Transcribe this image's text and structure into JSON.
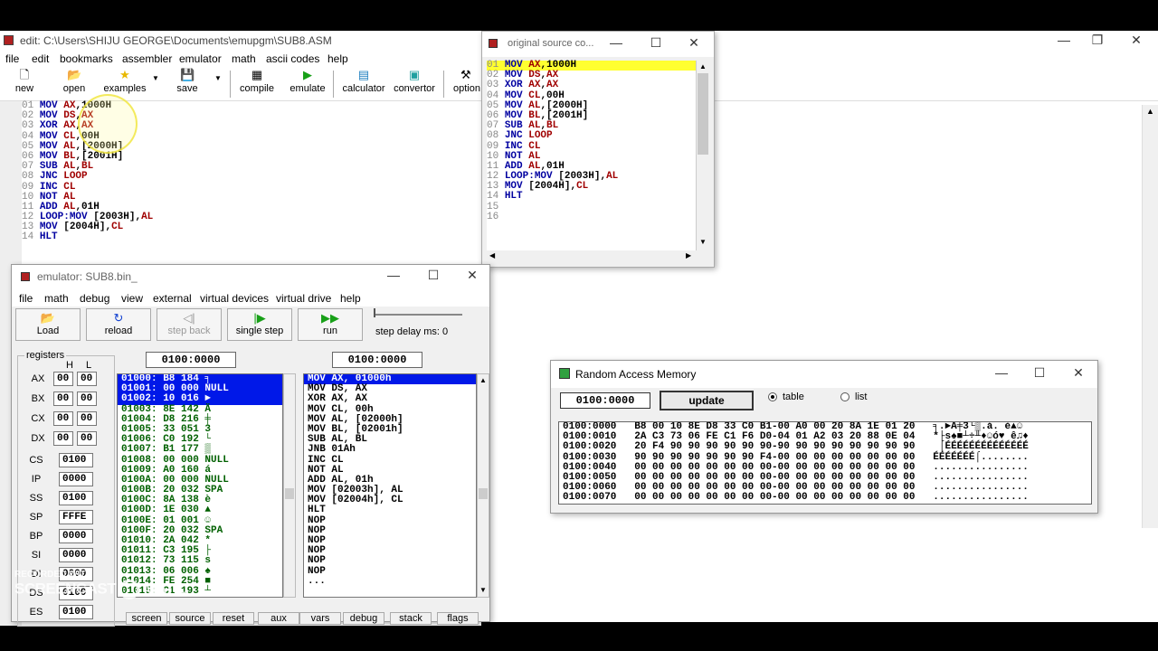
{
  "editor": {
    "title": "edit: C:\\Users\\SHIJU GEORGE\\Documents\\emupgm\\SUB8.ASM",
    "menu": [
      "file",
      "edit",
      "bookmarks",
      "assembler",
      "emulator",
      "math",
      "ascii codes",
      "help"
    ],
    "toolbar": {
      "new": "new",
      "open": "open",
      "examples": "examples",
      "save": "save",
      "compile": "compile",
      "emulate": "emulate",
      "calculator": "calculator",
      "convertor": "convertor",
      "options": "option"
    },
    "lines": [
      {
        "n": "01",
        "t": "MOV AX,1000H"
      },
      {
        "n": "02",
        "t": "MOV DS,AX"
      },
      {
        "n": "03",
        "t": "XOR AX,AX"
      },
      {
        "n": "04",
        "t": "MOV CL,00H"
      },
      {
        "n": "05",
        "t": "MOV AL,[2000H]"
      },
      {
        "n": "06",
        "t": "MOV BL,[2001H]"
      },
      {
        "n": "07",
        "t": "SUB AL,BL"
      },
      {
        "n": "08",
        "t": "JNC LOOP"
      },
      {
        "n": "09",
        "t": "INC CL"
      },
      {
        "n": "10",
        "t": "NOT AL"
      },
      {
        "n": "11",
        "t": "ADD AL,01H"
      },
      {
        "n": "12",
        "t": "LOOP:MOV [2003H],AL"
      },
      {
        "n": "13",
        "t": "MOV [2004H],CL"
      },
      {
        "n": "14",
        "t": "HLT"
      }
    ]
  },
  "source": {
    "title": "original source co...",
    "lines": [
      {
        "n": "01",
        "t": "MOV AX,1000H"
      },
      {
        "n": "02",
        "t": "MOV DS,AX"
      },
      {
        "n": "03",
        "t": "XOR AX,AX"
      },
      {
        "n": "04",
        "t": "MOV CL,00H"
      },
      {
        "n": "05",
        "t": "MOV AL,[2000H]"
      },
      {
        "n": "06",
        "t": "MOV BL,[2001H]"
      },
      {
        "n": "07",
        "t": "SUB AL,BL"
      },
      {
        "n": "08",
        "t": "JNC LOOP"
      },
      {
        "n": "09",
        "t": "INC CL"
      },
      {
        "n": "10",
        "t": "NOT AL"
      },
      {
        "n": "11",
        "t": "ADD AL,01H"
      },
      {
        "n": "12",
        "t": "LOOP:MOV [2003H],AL"
      },
      {
        "n": "13",
        "t": "MOV [2004H],CL"
      },
      {
        "n": "14",
        "t": "HLT"
      },
      {
        "n": "15",
        "t": ""
      },
      {
        "n": "16",
        "t": ""
      }
    ]
  },
  "emulator": {
    "title": "emulator: SUB8.bin_",
    "menu": [
      "file",
      "math",
      "debug",
      "view",
      "external",
      "virtual devices",
      "virtual drive",
      "help"
    ],
    "buttons": {
      "load": "Load",
      "reload": "reload",
      "step_back": "step back",
      "single_step": "single step",
      "run": "run"
    },
    "step_delay": "step delay ms: 0",
    "registers_label": "registers",
    "h_label": "H",
    "l_label": "L",
    "regs_hl": [
      {
        "name": "AX",
        "h": "00",
        "l": "00"
      },
      {
        "name": "BX",
        "h": "00",
        "l": "00"
      },
      {
        "name": "CX",
        "h": "00",
        "l": "00"
      },
      {
        "name": "DX",
        "h": "00",
        "l": "00"
      }
    ],
    "regs": [
      {
        "name": "CS",
        "v": "0100"
      },
      {
        "name": "IP",
        "v": "0000"
      },
      {
        "name": "SS",
        "v": "0100"
      },
      {
        "name": "SP",
        "v": "FFFE"
      },
      {
        "name": "BP",
        "v": "0000"
      },
      {
        "name": "SI",
        "v": "0000"
      },
      {
        "name": "DI",
        "v": "0000"
      },
      {
        "name": "DS",
        "v": "0100"
      },
      {
        "name": "ES",
        "v": "0100"
      }
    ],
    "mem_addr": "0100:0000",
    "dis_addr": "0100:0000",
    "memory": [
      "01000: B8 184 ╕",
      "01001: 00 000 NULL",
      "01002: 10 016 ►",
      "01003: 8E 142 Ä",
      "01004: D8 216 ╪",
      "01005: 33 051 3",
      "01006: C0 192 └",
      "01007: B1 177 ▒",
      "01008: 00 000 NULL",
      "01009: A0 160 á",
      "0100A: 00 000 NULL",
      "0100B: 20 032 SPA",
      "0100C: 8A 138 è",
      "0100D: 1E 030 ▲",
      "0100E: 01 001 ☺",
      "0100F: 20 032 SPA",
      "01010: 2A 042 *",
      "01011: C3 195 ├",
      "01012: 73 115 s",
      "01013: 06 006 ♠",
      "01014: FE 254 ■",
      "01015: C1 193 ┴"
    ],
    "disasm": [
      "MOV AX, 01000h",
      "MOV DS, AX",
      "XOR AX, AX",
      "MOV CL, 00h",
      "MOV AL, [02000h]",
      "MOV BL, [02001h]",
      "SUB AL, BL",
      "JNB 01Ah",
      "INC CL",
      "NOT AL",
      "ADD AL, 01h",
      "MOV [02003h], AL",
      "MOV [02004h], CL",
      "HLT",
      "NOP",
      "NOP",
      "NOP",
      "NOP",
      "NOP",
      "NOP",
      "..."
    ],
    "tabs": [
      "screen",
      "source",
      "reset",
      "aux",
      "vars",
      "debug",
      "stack",
      "flags"
    ]
  },
  "ram": {
    "title": "Random Access Memory",
    "addr": "0100:0000",
    "update": "update",
    "table": "table",
    "list": "list",
    "rows": [
      {
        "a": "0100:0000",
        "h": "B8 00 10 8E D8 33 C0 B1-00 A0 00 20 8A 1E 01 20",
        "c": "╕.►Ä╪3└▒.á. è▲☺ "
      },
      {
        "a": "0100:0010",
        "h": "2A C3 73 06 FE C1 F6 D0-04 01 A2 03 20 88 0E 04",
        "c": "*├s♠■┴÷╨♦☺ó♥ ê♫♦"
      },
      {
        "a": "0100:0020",
        "h": "20 F4 90 90 90 90 90 90-90 90 90 90 90 90 90 90",
        "c": " ⌠ÉÉÉÉÉÉÉÉÉÉÉÉÉÉ"
      },
      {
        "a": "0100:0030",
        "h": "90 90 90 90 90 90 90 F4-00 00 00 00 00 00 00 00",
        "c": "ÉÉÉÉÉÉÉ⌠........"
      },
      {
        "a": "0100:0040",
        "h": "00 00 00 00 00 00 00 00-00 00 00 00 00 00 00 00",
        "c": "................"
      },
      {
        "a": "0100:0050",
        "h": "00 00 00 00 00 00 00 00-00 00 00 00 00 00 00 00",
        "c": "................"
      },
      {
        "a": "0100:0060",
        "h": "00 00 00 00 00 00 00 00-00 00 00 00 00 00 00 00",
        "c": "................"
      },
      {
        "a": "0100:0070",
        "h": "00 00 00 00 00 00 00 00-00 00 00 00 00 00 00 00",
        "c": "................"
      }
    ]
  },
  "watermark": {
    "line1": "RECORDED WITH",
    "line2": "SCREENCAST",
    "line3": "MATIC"
  }
}
